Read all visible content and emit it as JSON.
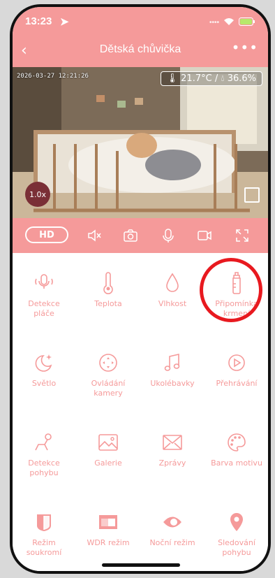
{
  "status": {
    "time": "13:23"
  },
  "header": {
    "title": "Dětská chůvička"
  },
  "video": {
    "timestamp": "2026-03-27 12:21:26",
    "temperature": "21.7°C",
    "humidity": "36.6%",
    "zoom": "1.0x"
  },
  "controls": {
    "quality_label": "HD"
  },
  "features": [
    {
      "label": "Detekce\npláče",
      "icon": "cry-detect-icon"
    },
    {
      "label": "Teplota",
      "icon": "thermometer-icon"
    },
    {
      "label": "Vlhkost",
      "icon": "droplet-icon"
    },
    {
      "label": "Připomínka\nkrmení",
      "icon": "bottle-icon"
    },
    {
      "label": "Světlo",
      "icon": "moon-star-icon"
    },
    {
      "label": "Ovládání\nkamery",
      "icon": "dpad-icon"
    },
    {
      "label": "Ukolébavky",
      "icon": "music-note-icon"
    },
    {
      "label": "Přehrávání",
      "icon": "play-icon"
    },
    {
      "label": "Detekce\npohybu",
      "icon": "baby-crawl-icon"
    },
    {
      "label": "Galerie",
      "icon": "gallery-icon"
    },
    {
      "label": "Zprávy",
      "icon": "envelope-icon"
    },
    {
      "label": "Barva motivu",
      "icon": "palette-icon"
    },
    {
      "label": "Režim\nsoukromí",
      "icon": "privacy-icon"
    },
    {
      "label": "WDR režim",
      "icon": "wdr-icon"
    },
    {
      "label": "Noční režim",
      "icon": "eye-icon"
    },
    {
      "label": "Sledování\npohybu",
      "icon": "location-pin-icon"
    }
  ],
  "colors": {
    "accent": "#f59a9a",
    "highlight_circle": "#e8191f"
  }
}
